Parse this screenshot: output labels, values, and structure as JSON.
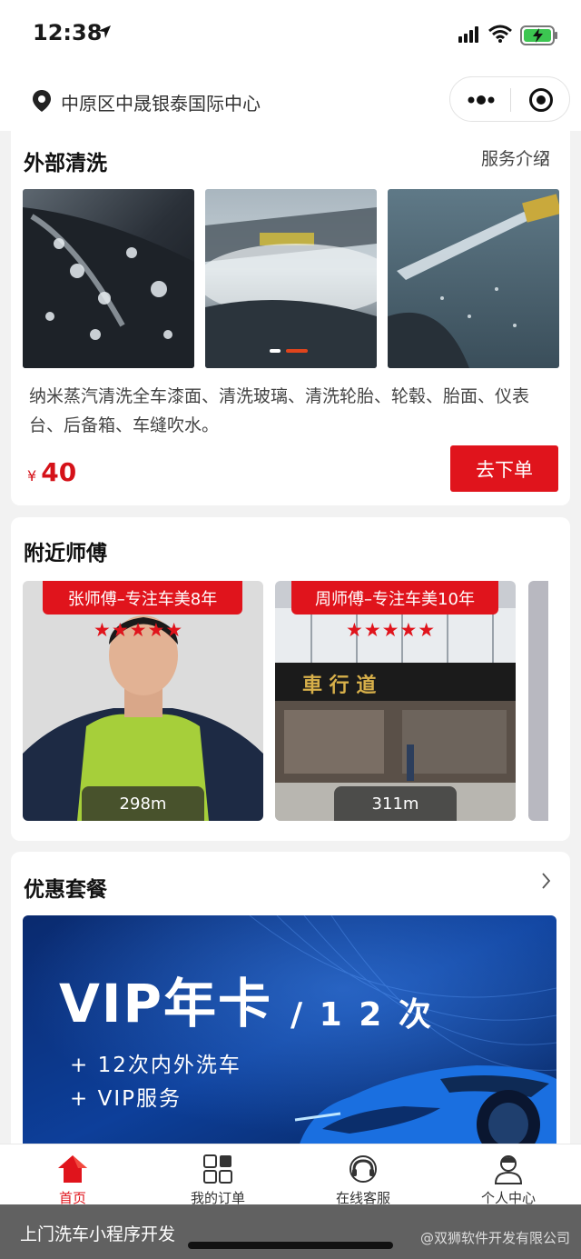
{
  "status_bar": {
    "time": "12:38"
  },
  "nav": {
    "location": "中原区中晟银泰国际中心"
  },
  "exterior_wash": {
    "title": "外部清洗",
    "service_intro": "服务介绍",
    "description": "纳米蒸汽清洗全车漆面、清洗玻璃、清洗轮胎、轮毂、胎面、仪表台、后备箱、车缝吹水。",
    "currency": "¥",
    "price": "40",
    "order_button": "去下单"
  },
  "nearby": {
    "title": "附近师傅",
    "masters": [
      {
        "name": "张师傅–专注车美8年",
        "stars": "★★★★★",
        "distance": "298m"
      },
      {
        "name": "周师傅–专注车美10年",
        "stars": "★★★★★",
        "distance": "311m",
        "shop_sign": "車 行 道"
      }
    ]
  },
  "packages": {
    "title": "优惠套餐",
    "vip_title": "VIP年卡",
    "vip_sub": "/ 1 2 次",
    "line1": "+ 12次内外洗车",
    "line2": "+ VIP服务"
  },
  "tabs": [
    {
      "label": "首页",
      "active": true
    },
    {
      "label": "我的订单"
    },
    {
      "label": "在线客服"
    },
    {
      "label": "个人中心"
    }
  ],
  "watermark": {
    "left": "上门洗车小程序开发",
    "right": "@双狮软件开发有限公司"
  },
  "colors": {
    "accent": "#e0141c",
    "background": "#f2f2f2"
  }
}
